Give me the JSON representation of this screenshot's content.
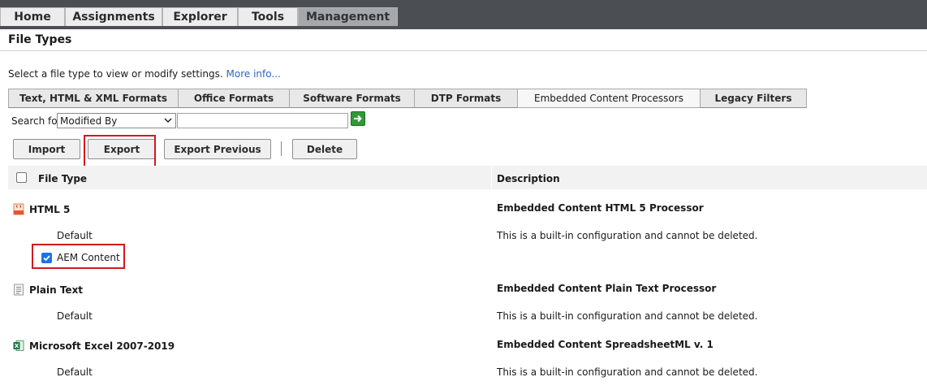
{
  "nav": {
    "tabs": [
      {
        "label": "Home"
      },
      {
        "label": "Assignments"
      },
      {
        "label": "Explorer"
      },
      {
        "label": "Tools"
      },
      {
        "label": "Management",
        "active": true
      }
    ]
  },
  "page": {
    "title": "File Types",
    "intro": "Select a file type to view or modify settings.",
    "more_info": "More info..."
  },
  "format_tabs": [
    {
      "label": "Text, HTML & XML Formats"
    },
    {
      "label": "Office Formats"
    },
    {
      "label": "Software Formats"
    },
    {
      "label": "DTP Formats"
    },
    {
      "label": "Embedded Content Processors",
      "active": true
    },
    {
      "label": "Legacy Filters"
    }
  ],
  "search": {
    "label": "Search for:",
    "selected": "Modified By",
    "value": ""
  },
  "actions": {
    "import": "Import",
    "export": "Export",
    "export_previous": "Export Previous",
    "delete": "Delete"
  },
  "table": {
    "columns": {
      "file_type": "File Type",
      "description": "Description"
    },
    "groups": [
      {
        "name": "HTML 5",
        "icon": "html5-file-icon",
        "description": "Embedded Content HTML 5 Processor",
        "configs": [
          {
            "name": "Default",
            "description": "This is a built-in configuration and cannot be deleted.",
            "checkbox": false
          },
          {
            "name": "AEM Content",
            "description": "",
            "checkbox": true,
            "checked": true
          }
        ]
      },
      {
        "name": "Plain Text",
        "icon": "text-file-icon",
        "description": "Embedded Content Plain Text Processor",
        "configs": [
          {
            "name": "Default",
            "description": "This is a built-in configuration and cannot be deleted.",
            "checkbox": false
          }
        ]
      },
      {
        "name": "Microsoft Excel 2007-2019",
        "icon": "excel-file-icon",
        "description": "Embedded Content SpreadsheetML v. 1",
        "configs": [
          {
            "name": "Default",
            "description": "This is a built-in configuration and cannot be deleted.",
            "checkbox": false
          }
        ]
      }
    ]
  },
  "colors": {
    "topbar": "#4b4f54",
    "highlight": "#d0191f",
    "link": "#2a66c6",
    "checkbox": "#1a73e8"
  }
}
